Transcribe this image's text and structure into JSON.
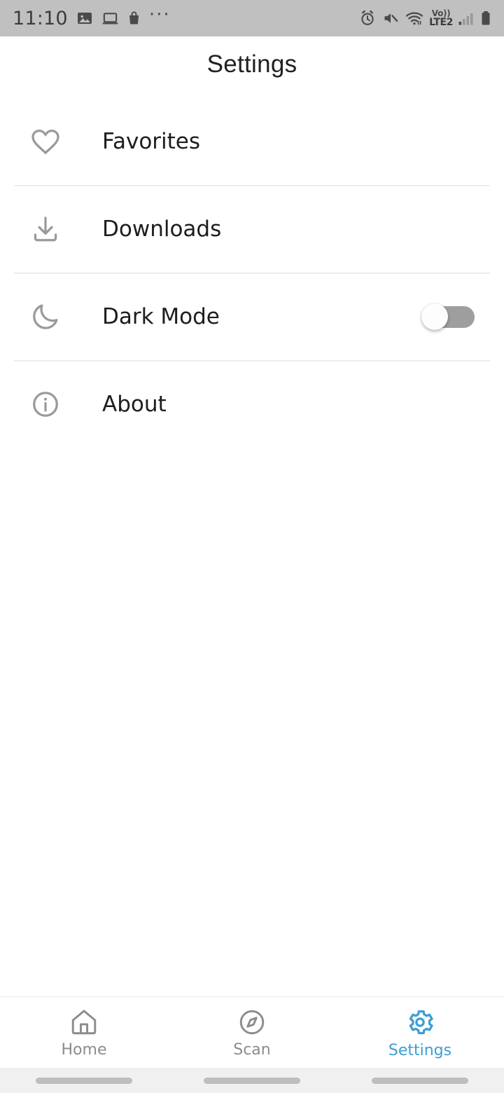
{
  "status_bar": {
    "time": "11:10",
    "left_icons": [
      "image-icon",
      "laptop-icon",
      "shopping-bag-icon",
      "overflow-dots-icon"
    ],
    "overflow": "···",
    "right_icons": [
      "alarm-icon",
      "mute-icon",
      "wifi-icon",
      "signal-bars-icon",
      "battery-icon"
    ],
    "network_label_top": "Vo))",
    "network_label_bottom": "LTE2",
    "background_color": "#c0c0c0"
  },
  "header": {
    "title": "Settings"
  },
  "settings_list": [
    {
      "icon": "heart-icon",
      "label": "Favorites",
      "control": "none"
    },
    {
      "icon": "download-icon",
      "label": "Downloads",
      "control": "none"
    },
    {
      "icon": "moon-icon",
      "label": "Dark Mode",
      "control": "toggle",
      "toggle_state": "off"
    },
    {
      "icon": "info-icon",
      "label": "About",
      "control": "none"
    }
  ],
  "bottom_nav": {
    "items": [
      {
        "icon": "home-icon",
        "label": "Home",
        "active": false
      },
      {
        "icon": "compass-icon",
        "label": "Scan",
        "active": false
      },
      {
        "icon": "gear-icon",
        "label": "Settings",
        "active": true
      }
    ],
    "active_color": "#3d9ed3",
    "inactive_color": "#8c8c8c"
  },
  "gesture_bar": {
    "background_color": "#f0f0f0",
    "pill_color": "#bdbdbd",
    "pill_count": 3
  }
}
